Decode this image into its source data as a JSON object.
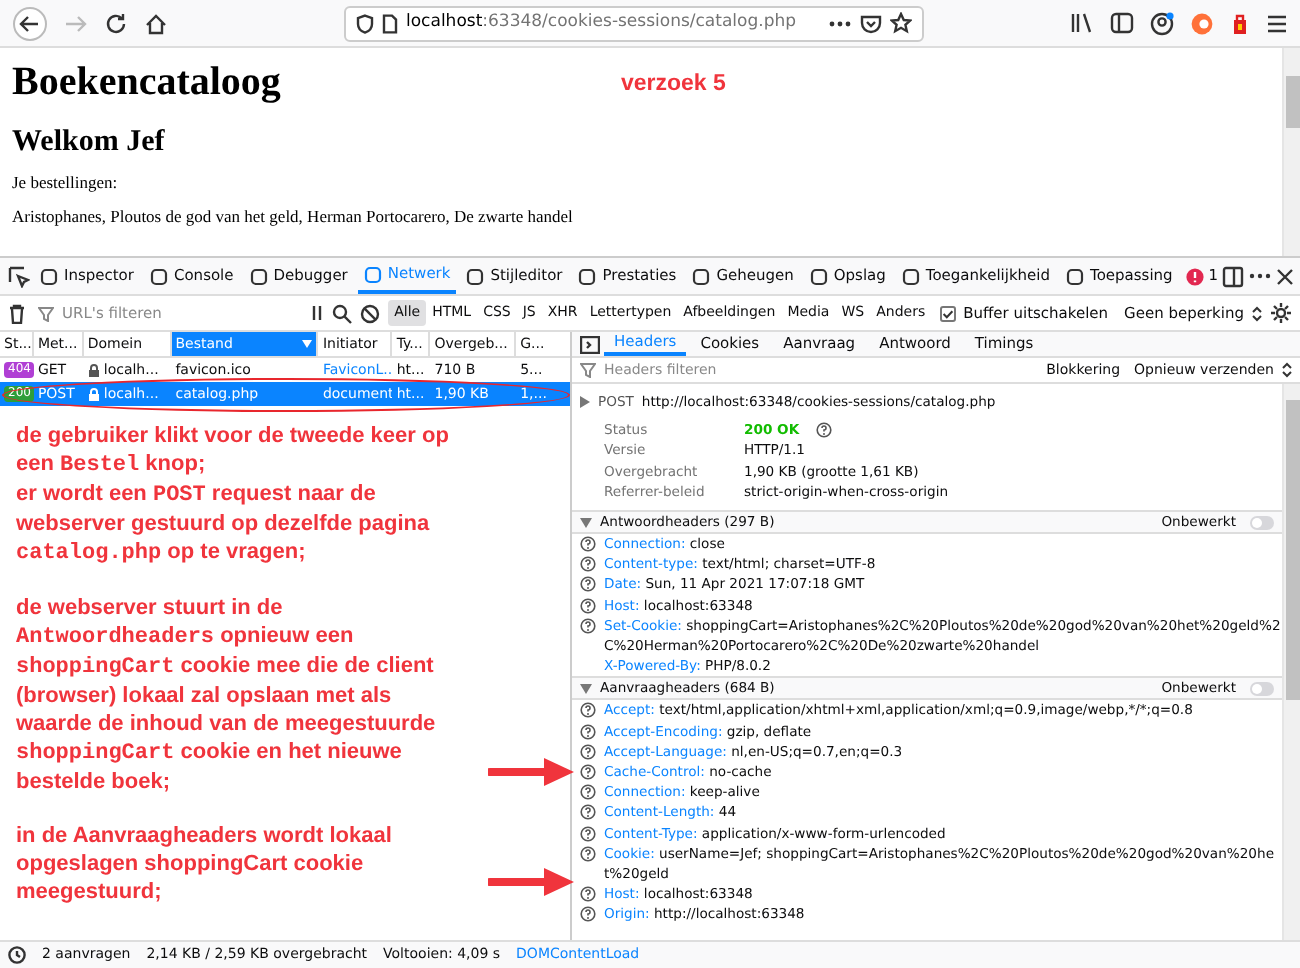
{
  "browser": {
    "url_host": "localhost",
    "url_path": ":63348/cookies-sessions/catalog.php",
    "forward_disabled": true
  },
  "page": {
    "title": "Boekencataloog",
    "annotation": "verzoek 5",
    "welcome": "Welkom Jef",
    "orders_label": "Je bestellingen:",
    "orders": "Aristophanes, Ploutos de god van het geld, Herman Portocarero, De zwarte handel"
  },
  "devtools": {
    "tabs": [
      {
        "label": "Inspector",
        "selected": false
      },
      {
        "label": "Console",
        "selected": false
      },
      {
        "label": "Debugger",
        "selected": false
      },
      {
        "label": "Netwerk",
        "selected": true
      },
      {
        "label": "Stijleditor",
        "selected": false
      },
      {
        "label": "Prestaties",
        "selected": false
      },
      {
        "label": "Geheugen",
        "selected": false
      },
      {
        "label": "Opslag",
        "selected": false
      },
      {
        "label": "Toegankelijkheid",
        "selected": false
      },
      {
        "label": "Toepassing",
        "selected": false
      }
    ],
    "error_count": "1",
    "filter_placeholder": "URL's filteren",
    "type_filters": [
      {
        "label": "Alle",
        "selected": true
      },
      {
        "label": "HTML",
        "selected": false
      },
      {
        "label": "CSS",
        "selected": false
      },
      {
        "label": "JS",
        "selected": false
      },
      {
        "label": "XHR",
        "selected": false
      },
      {
        "label": "Lettertypen",
        "selected": false
      },
      {
        "label": "Afbeeldingen",
        "selected": false
      },
      {
        "label": "Media",
        "selected": false
      },
      {
        "label": "WS",
        "selected": false
      },
      {
        "label": "Anders",
        "selected": false
      }
    ],
    "disable_cache": {
      "label": "Buffer uitschakelen",
      "checked": true
    },
    "throttling": "Geen beperking",
    "columns": [
      {
        "label": "St...",
        "sorted": false
      },
      {
        "label": "Met...",
        "sorted": false
      },
      {
        "label": "Domein",
        "sorted": false
      },
      {
        "label": "Bestand",
        "sorted": true
      },
      {
        "label": "Initiator",
        "sorted": false
      },
      {
        "label": "Ty...",
        "sorted": false
      },
      {
        "label": "Overgeb...",
        "sorted": false
      },
      {
        "label": "G...",
        "sorted": false
      }
    ],
    "requests": [
      {
        "status": "404",
        "color": "#b03fd4",
        "method": "GET",
        "domain": "localh...",
        "file": "favicon.ico",
        "initiator": "FaviconL...",
        "type": "ht...",
        "transferred": "710 B",
        "size": "5...",
        "selected": false
      },
      {
        "status": "200",
        "color": "#2e9e3a",
        "method": "POST",
        "domain": "localh...",
        "file": "catalog.php",
        "initiator": "document",
        "type": "ht...",
        "transferred": "1,90 KB",
        "size": "1,...",
        "selected": true
      }
    ],
    "detail_tabs": [
      {
        "label": "Headers",
        "selected": true
      },
      {
        "label": "Cookies",
        "selected": false
      },
      {
        "label": "Aanvraag",
        "selected": false
      },
      {
        "label": "Antwoord",
        "selected": false
      },
      {
        "label": "Timings",
        "selected": false
      }
    ],
    "headers_filter_placeholder": "Headers filteren",
    "blocking": "Blokkering",
    "resend": "Opnieuw verzenden",
    "request_line": {
      "method": "POST",
      "url": "http://localhost:63348/cookies-sessions/catalog.php"
    },
    "summary": [
      {
        "label": "Status",
        "value": "200 OK",
        "kind": "status"
      },
      {
        "label": "Versie",
        "value": "HTTP/1.1",
        "kind": "text"
      },
      {
        "label": "Overgebracht",
        "value": "1,90 KB (grootte 1,61 KB)",
        "kind": "text"
      },
      {
        "label": "Referrer-beleid",
        "value": "strict-origin-when-cross-origin",
        "kind": "text"
      }
    ],
    "sections": [
      {
        "title": "Antwoordheaders (297 B)",
        "raw_label": "Onbewerkt",
        "raw_on": false,
        "headers": [
          {
            "name": "Connection:",
            "value": "close",
            "help": true
          },
          {
            "name": "Content-type:",
            "value": "text/html; charset=UTF-8",
            "help": true
          },
          {
            "name": "Date:",
            "value": "Sun, 11 Apr 2021 17:07:18 GMT",
            "help": true
          },
          {
            "name": "Host:",
            "value": "localhost:63348",
            "help": true
          },
          {
            "name": "Set-Cookie:",
            "value": "shoppingCart=Aristophanes%2C%20Ploutos%20de%20god%20van%20het%20geld%2C%20Herman%20Portocarero%2C%20De%20zwarte%20handel",
            "help": true
          },
          {
            "name": "X-Powered-By:",
            "value": "PHP/8.0.2",
            "help": false
          }
        ]
      },
      {
        "title": "Aanvraagheaders (684 B)",
        "raw_label": "Onbewerkt",
        "raw_on": false,
        "headers": [
          {
            "name": "Accept:",
            "value": "text/html,application/xhtml+xml,application/xml;q=0.9,image/webp,*/*;q=0.8",
            "help": true
          },
          {
            "name": "Accept-Encoding:",
            "value": "gzip, deflate",
            "help": true
          },
          {
            "name": "Accept-Language:",
            "value": "nl,en-US;q=0.7,en;q=0.3",
            "help": true
          },
          {
            "name": "Cache-Control:",
            "value": "no-cache",
            "help": true
          },
          {
            "name": "Connection:",
            "value": "keep-alive",
            "help": true
          },
          {
            "name": "Content-Length:",
            "value": "44",
            "help": true
          },
          {
            "name": "Content-Type:",
            "value": "application/x-www-form-urlencoded",
            "help": true
          },
          {
            "name": "Cookie:",
            "value": "userName=Jef; shoppingCart=Aristophanes%2C%20Ploutos%20de%20god%20van%20het%20geld",
            "help": true
          },
          {
            "name": "Host:",
            "value": "localhost:63348",
            "help": true
          },
          {
            "name": "Origin:",
            "value": "http://localhost:63348",
            "help": true
          }
        ]
      }
    ],
    "status_bar": [
      "2 aanvragen",
      "2,14 KB / 2,59 KB overgebracht",
      "Voltooien: 4,09 s",
      "DOMContentLoad"
    ]
  },
  "annotations": [
    {
      "arrow": false,
      "segments": [
        {
          "kind": "text",
          "text": "de gebruiker klikt voor de tweede keer op een "
        },
        {
          "kind": "code",
          "text": "Bestel"
        },
        {
          "kind": "text",
          "text": " knop;\ner wordt een "
        },
        {
          "kind": "code",
          "text": "POST"
        },
        {
          "kind": "text",
          "text": " request naar de webserver gestuurd op dezelfde pagina "
        },
        {
          "kind": "code",
          "text": "catalog.php"
        },
        {
          "kind": "text",
          "text": " op te vragen;"
        }
      ]
    },
    {
      "arrow": true,
      "segments": [
        {
          "kind": "text",
          "text": "de webserver stuurt in de "
        },
        {
          "kind": "code",
          "text": "Antwoordheaders"
        },
        {
          "kind": "text",
          "text": " opnieuw een "
        },
        {
          "kind": "code",
          "text": "shoppingCart"
        },
        {
          "kind": "text",
          "text": " cookie mee die de client (browser) lokaal zal opslaan met als waarde de inhoud van de meegestuurde "
        },
        {
          "kind": "code",
          "text": "shoppingCart"
        },
        {
          "kind": "text",
          "text": " cookie en het nieuwe bestelde boek;"
        }
      ]
    },
    {
      "arrow": true,
      "segments": [
        {
          "kind": "text",
          "text": "in de Aanvraagheaders wordt lokaal opgeslagen shoppingCart cookie meegestuurd;"
        }
      ]
    }
  ]
}
